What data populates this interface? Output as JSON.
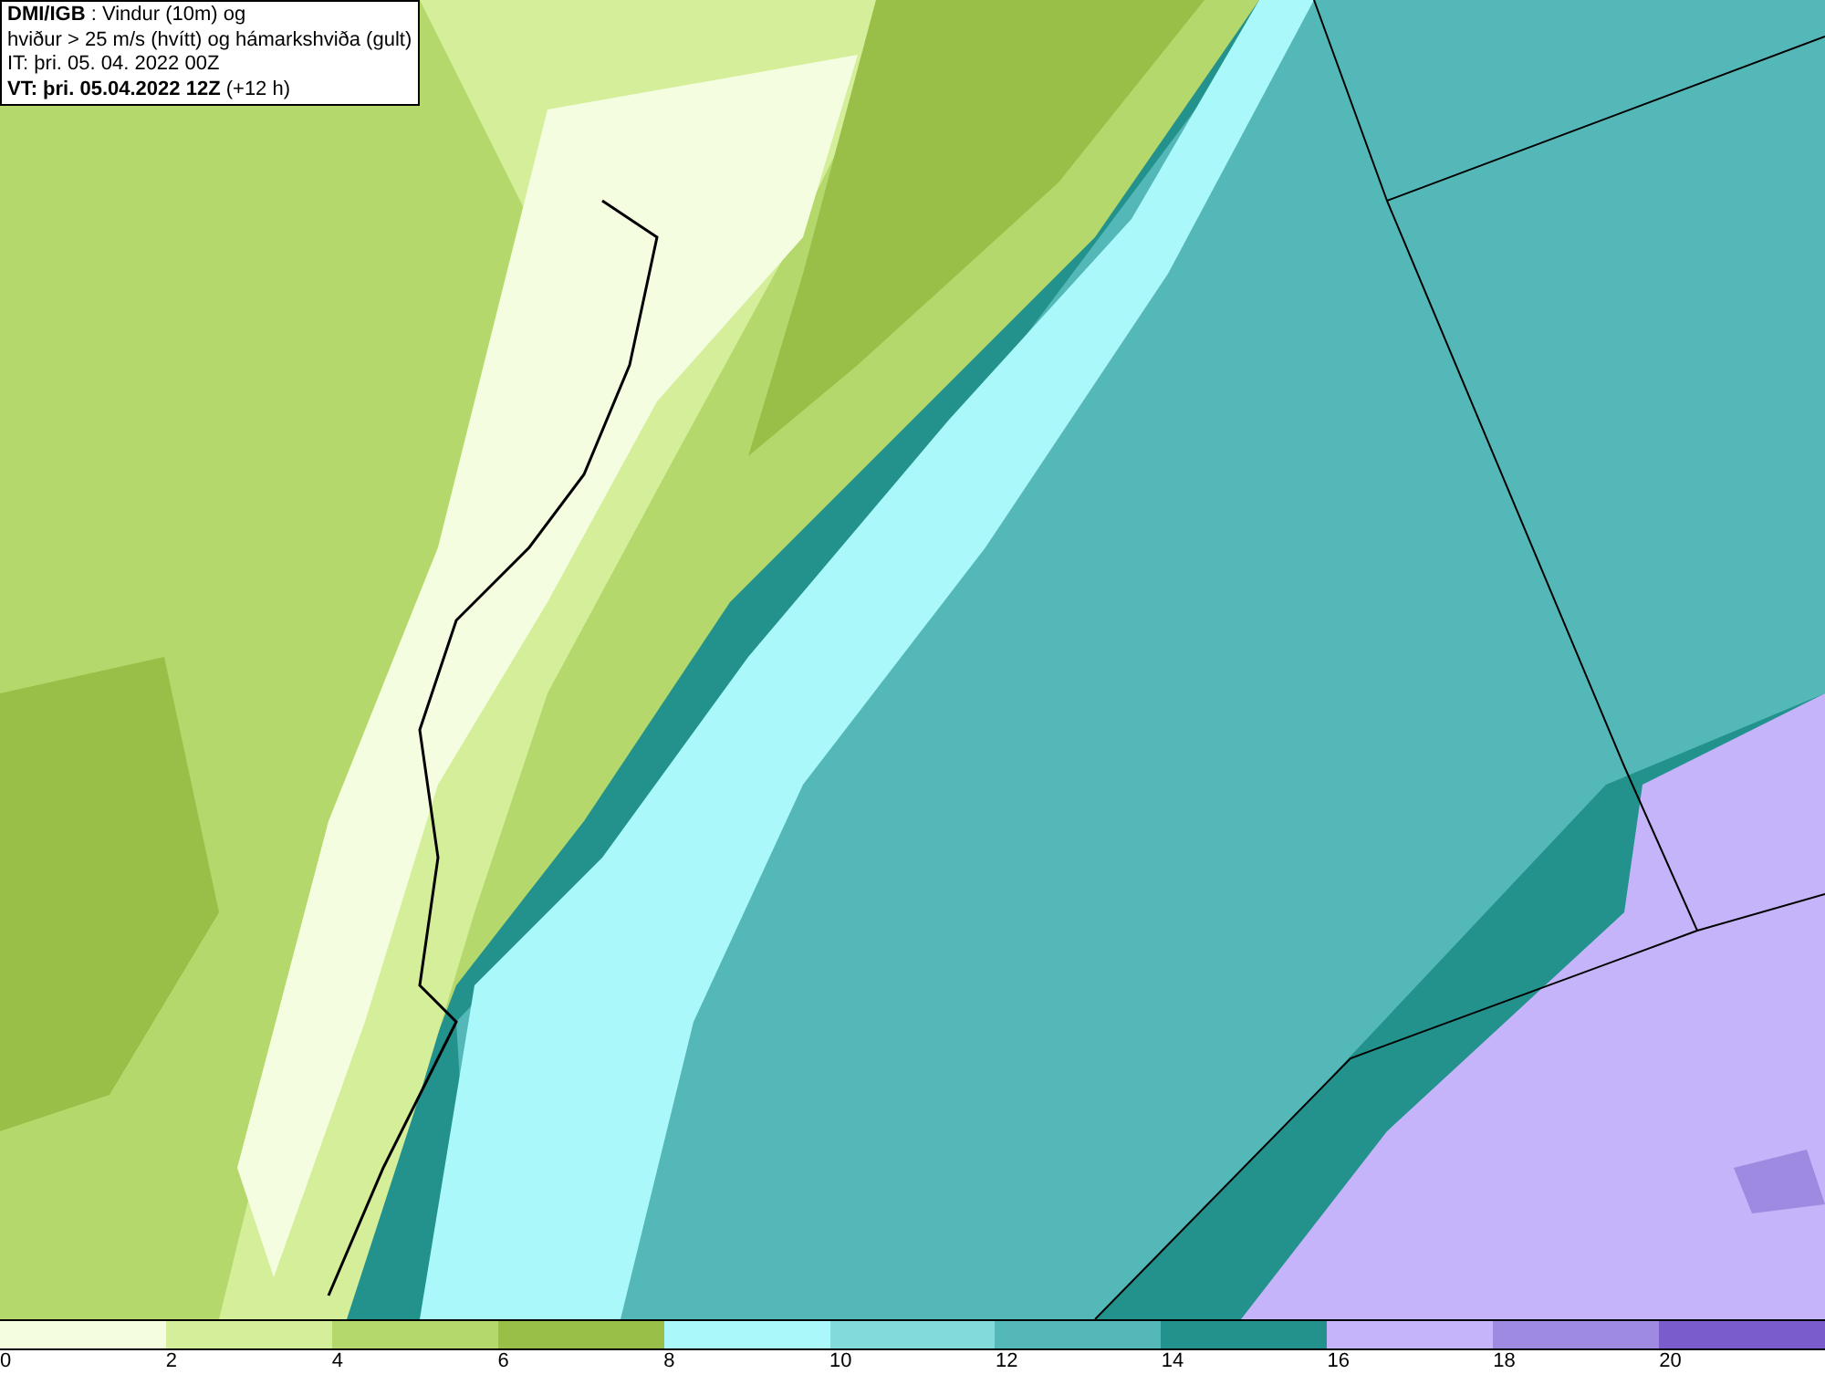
{
  "title_box": {
    "lines": [
      "**DMI/IGB** : Vindur (10m) og",
      "hviður > 25 m/s (hvítt) og hámarkshviða (gult)",
      "IT: þri. 05. 04. 2022 00Z",
      "**VT: þri. 05.04.2022 12Z** (+12 h)"
    ]
  },
  "legend": [
    {
      "label": "0",
      "color": "#f5fde0"
    },
    {
      "label": "2",
      "color": "#d4ee9a"
    },
    {
      "label": "4",
      "color": "#b5d86c"
    },
    {
      "label": "6",
      "color": "#9abf48"
    },
    {
      "label": "8",
      "color": "#aaf8fa"
    },
    {
      "label": "10",
      "color": "#83dada"
    },
    {
      "label": "12",
      "color": "#55b8b8"
    },
    {
      "label": "14",
      "color": "#24928c"
    },
    {
      "label": "16",
      "color": "#c6b4fa"
    },
    {
      "label": "18",
      "color": "#9e8ae0"
    },
    {
      "label": "20",
      "color": "#7a5ccc"
    }
  ]
}
